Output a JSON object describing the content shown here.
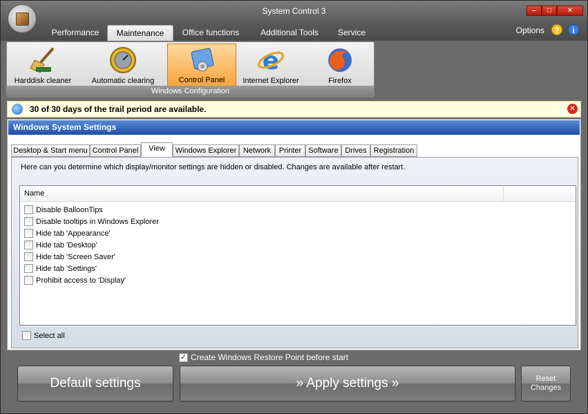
{
  "window": {
    "title": "System Control 3"
  },
  "ribbon": {
    "tabs": [
      {
        "label": "Performance"
      },
      {
        "label": "Maintenance"
      },
      {
        "label": "Office functions"
      },
      {
        "label": "Additional Tools"
      },
      {
        "label": "Service"
      }
    ],
    "active_tab": "Maintenance",
    "options_label": "Options",
    "help_glyph": "?",
    "info_glyph": "i",
    "buttons": [
      {
        "label": "Harddisk cleaner",
        "icon": "broom-icon"
      },
      {
        "label": "Automatic clearing",
        "icon": "clock-icon"
      },
      {
        "label": "Control Panel",
        "icon": "control-panel-icon"
      },
      {
        "label": "Internet Explorer",
        "icon": "internet-explorer-icon"
      },
      {
        "label": "Firefox",
        "icon": "firefox-icon"
      }
    ],
    "active_button": "Control Panel",
    "group_caption": "Windows Configuration"
  },
  "notification": {
    "text": "30 of 30 days of the trail period are available."
  },
  "section": {
    "title": "Windows System Settings"
  },
  "settings_tabs": [
    {
      "label": "Desktop & Start menu"
    },
    {
      "label": "Control Panel"
    },
    {
      "label": "View"
    },
    {
      "label": "Windows Explorer"
    },
    {
      "label": "Network"
    },
    {
      "label": "Printer"
    },
    {
      "label": "Software"
    },
    {
      "label": "Drives"
    },
    {
      "label": "Registration"
    }
  ],
  "active_settings_tab": "View",
  "view": {
    "description": "Here can you determine which display/monitor settings are hidden or disabled. Changes are available after restart.",
    "column_name": "Name",
    "items": [
      {
        "label": "Disable BalloonTips",
        "checked": false
      },
      {
        "label": "Disable tooltips in Windows Explorer",
        "checked": false
      },
      {
        "label": "Hide tab 'Appearance'",
        "checked": false
      },
      {
        "label": "Hide tab 'Desktop'",
        "checked": false
      },
      {
        "label": "Hide tab 'Screen Saver'",
        "checked": false
      },
      {
        "label": "Hide tab 'Settings'",
        "checked": false
      },
      {
        "label": "Prohibit access to 'Display'",
        "checked": false
      }
    ],
    "select_all_label": "Select all"
  },
  "footer": {
    "restore_point_label": "Create Windows Restore Point before start",
    "restore_point_checked": true,
    "default_button": "Default settings",
    "apply_button": "» Apply settings »",
    "reset_button_line1": "Reset",
    "reset_button_line2": "Changes"
  },
  "colors": {
    "window_bg": "#6b6b6b",
    "active_ribbon_button": "#f7a43d",
    "section_header": "#1f4fa6",
    "notification_bg": "#fffee0"
  }
}
